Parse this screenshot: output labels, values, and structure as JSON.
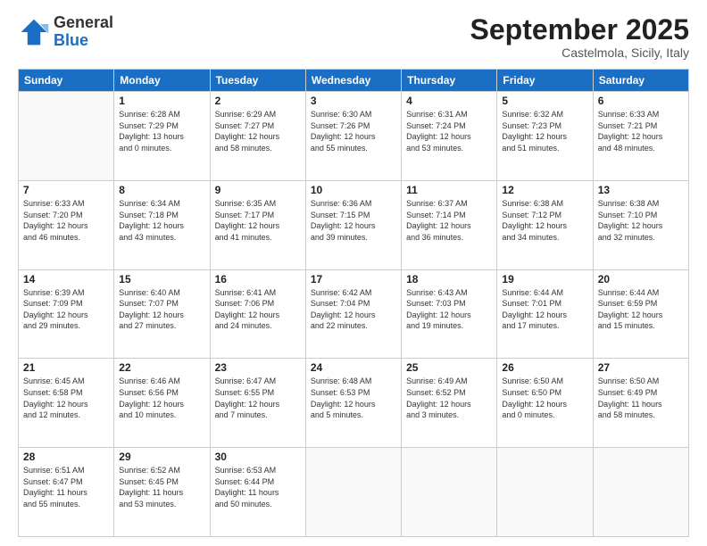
{
  "logo": {
    "general": "General",
    "blue": "Blue"
  },
  "header": {
    "month": "September 2025",
    "location": "Castelmola, Sicily, Italy"
  },
  "days_of_week": [
    "Sunday",
    "Monday",
    "Tuesday",
    "Wednesday",
    "Thursday",
    "Friday",
    "Saturday"
  ],
  "weeks": [
    [
      {
        "day": "",
        "info": ""
      },
      {
        "day": "1",
        "info": "Sunrise: 6:28 AM\nSunset: 7:29 PM\nDaylight: 13 hours\nand 0 minutes."
      },
      {
        "day": "2",
        "info": "Sunrise: 6:29 AM\nSunset: 7:27 PM\nDaylight: 12 hours\nand 58 minutes."
      },
      {
        "day": "3",
        "info": "Sunrise: 6:30 AM\nSunset: 7:26 PM\nDaylight: 12 hours\nand 55 minutes."
      },
      {
        "day": "4",
        "info": "Sunrise: 6:31 AM\nSunset: 7:24 PM\nDaylight: 12 hours\nand 53 minutes."
      },
      {
        "day": "5",
        "info": "Sunrise: 6:32 AM\nSunset: 7:23 PM\nDaylight: 12 hours\nand 51 minutes."
      },
      {
        "day": "6",
        "info": "Sunrise: 6:33 AM\nSunset: 7:21 PM\nDaylight: 12 hours\nand 48 minutes."
      }
    ],
    [
      {
        "day": "7",
        "info": "Sunrise: 6:33 AM\nSunset: 7:20 PM\nDaylight: 12 hours\nand 46 minutes."
      },
      {
        "day": "8",
        "info": "Sunrise: 6:34 AM\nSunset: 7:18 PM\nDaylight: 12 hours\nand 43 minutes."
      },
      {
        "day": "9",
        "info": "Sunrise: 6:35 AM\nSunset: 7:17 PM\nDaylight: 12 hours\nand 41 minutes."
      },
      {
        "day": "10",
        "info": "Sunrise: 6:36 AM\nSunset: 7:15 PM\nDaylight: 12 hours\nand 39 minutes."
      },
      {
        "day": "11",
        "info": "Sunrise: 6:37 AM\nSunset: 7:14 PM\nDaylight: 12 hours\nand 36 minutes."
      },
      {
        "day": "12",
        "info": "Sunrise: 6:38 AM\nSunset: 7:12 PM\nDaylight: 12 hours\nand 34 minutes."
      },
      {
        "day": "13",
        "info": "Sunrise: 6:38 AM\nSunset: 7:10 PM\nDaylight: 12 hours\nand 32 minutes."
      }
    ],
    [
      {
        "day": "14",
        "info": "Sunrise: 6:39 AM\nSunset: 7:09 PM\nDaylight: 12 hours\nand 29 minutes."
      },
      {
        "day": "15",
        "info": "Sunrise: 6:40 AM\nSunset: 7:07 PM\nDaylight: 12 hours\nand 27 minutes."
      },
      {
        "day": "16",
        "info": "Sunrise: 6:41 AM\nSunset: 7:06 PM\nDaylight: 12 hours\nand 24 minutes."
      },
      {
        "day": "17",
        "info": "Sunrise: 6:42 AM\nSunset: 7:04 PM\nDaylight: 12 hours\nand 22 minutes."
      },
      {
        "day": "18",
        "info": "Sunrise: 6:43 AM\nSunset: 7:03 PM\nDaylight: 12 hours\nand 19 minutes."
      },
      {
        "day": "19",
        "info": "Sunrise: 6:44 AM\nSunset: 7:01 PM\nDaylight: 12 hours\nand 17 minutes."
      },
      {
        "day": "20",
        "info": "Sunrise: 6:44 AM\nSunset: 6:59 PM\nDaylight: 12 hours\nand 15 minutes."
      }
    ],
    [
      {
        "day": "21",
        "info": "Sunrise: 6:45 AM\nSunset: 6:58 PM\nDaylight: 12 hours\nand 12 minutes."
      },
      {
        "day": "22",
        "info": "Sunrise: 6:46 AM\nSunset: 6:56 PM\nDaylight: 12 hours\nand 10 minutes."
      },
      {
        "day": "23",
        "info": "Sunrise: 6:47 AM\nSunset: 6:55 PM\nDaylight: 12 hours\nand 7 minutes."
      },
      {
        "day": "24",
        "info": "Sunrise: 6:48 AM\nSunset: 6:53 PM\nDaylight: 12 hours\nand 5 minutes."
      },
      {
        "day": "25",
        "info": "Sunrise: 6:49 AM\nSunset: 6:52 PM\nDaylight: 12 hours\nand 3 minutes."
      },
      {
        "day": "26",
        "info": "Sunrise: 6:50 AM\nSunset: 6:50 PM\nDaylight: 12 hours\nand 0 minutes."
      },
      {
        "day": "27",
        "info": "Sunrise: 6:50 AM\nSunset: 6:49 PM\nDaylight: 11 hours\nand 58 minutes."
      }
    ],
    [
      {
        "day": "28",
        "info": "Sunrise: 6:51 AM\nSunset: 6:47 PM\nDaylight: 11 hours\nand 55 minutes."
      },
      {
        "day": "29",
        "info": "Sunrise: 6:52 AM\nSunset: 6:45 PM\nDaylight: 11 hours\nand 53 minutes."
      },
      {
        "day": "30",
        "info": "Sunrise: 6:53 AM\nSunset: 6:44 PM\nDaylight: 11 hours\nand 50 minutes."
      },
      {
        "day": "",
        "info": ""
      },
      {
        "day": "",
        "info": ""
      },
      {
        "day": "",
        "info": ""
      },
      {
        "day": "",
        "info": ""
      }
    ]
  ]
}
